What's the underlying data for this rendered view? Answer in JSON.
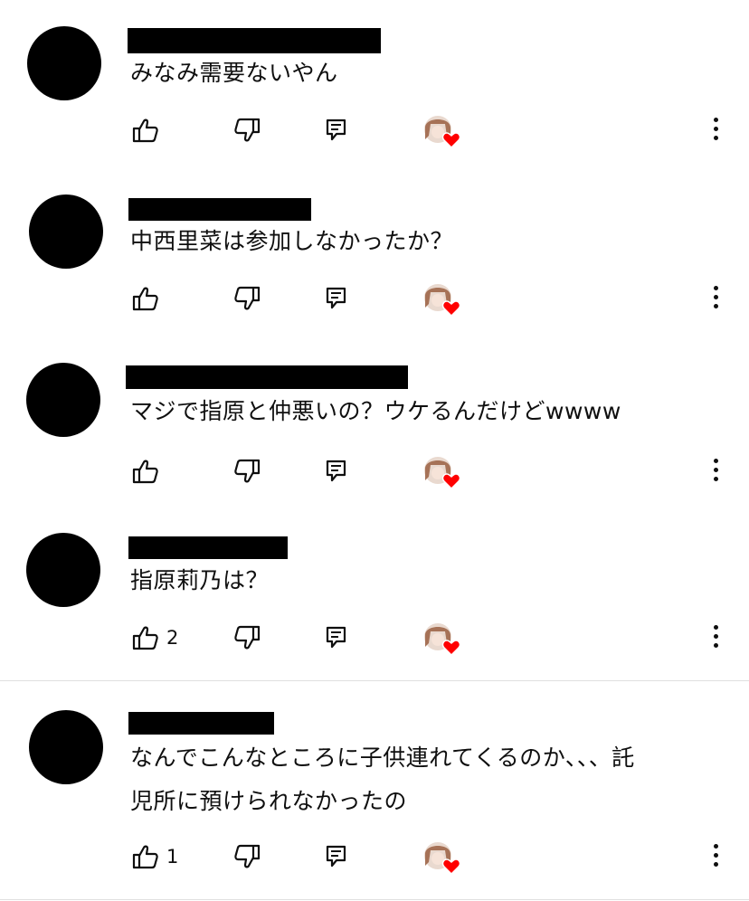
{
  "comments": [
    {
      "author": "",
      "text": "みなみ需要ないやん",
      "likes": ""
    },
    {
      "author": "",
      "text": "中西里菜は参加しなかったか？",
      "likes": ""
    },
    {
      "author": "",
      "text": "マジで指原と仲悪いの？ウケるんだけどwwww",
      "likes": ""
    },
    {
      "author": "",
      "text": "指原莉乃は？",
      "likes": "2"
    },
    {
      "author": "",
      "text": "なんでこんなところに子供連れてくるのか、、、託\n児所に預けられなかったの",
      "likes": "1"
    }
  ],
  "icons": {
    "like": "thumb-up-icon",
    "dislike": "thumb-down-icon",
    "reply": "reply-icon",
    "creator_heart": "creator-heart-avatar",
    "more": "more-vertical-icon"
  },
  "colors": {
    "heart": "#ff0000",
    "text": "#0f0f0f",
    "redaction": "#000000"
  }
}
